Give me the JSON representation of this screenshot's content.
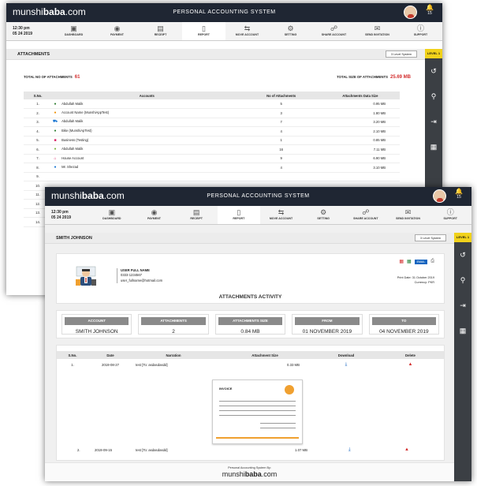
{
  "app": {
    "logo_prefix": "munshi",
    "logo_brand": "baba",
    "logo_suffix": ".com",
    "title": "PERSONAL ACCOUNTING SYSTEM",
    "notification_count": "15",
    "time": "12:30 pm",
    "date": "05 24 2019"
  },
  "nav": [
    {
      "label": "DASHBOARD",
      "icon": "dashboard-icon"
    },
    {
      "label": "PAYMENT",
      "icon": "payment-icon"
    },
    {
      "label": "RECEIPT",
      "icon": "receipt-icon"
    },
    {
      "label": "REPORT",
      "icon": "report-icon",
      "active": true
    },
    {
      "label": "MOVE ACCOUNT",
      "icon": "move-account-icon"
    },
    {
      "label": "SETTING",
      "icon": "gear-icon"
    },
    {
      "label": "SHARE ACCOUNT",
      "icon": "share-icon"
    },
    {
      "label": "SEND INVITATION",
      "icon": "invitation-icon"
    },
    {
      "label": "SUPPORT",
      "icon": "help-icon"
    }
  ],
  "sidebar": {
    "level": "LEVEL 1"
  },
  "level_system_btn": "3 Level System",
  "attachments_window": {
    "title": "ATTACHMENTS",
    "total_no_label": "TOTAL NO OF ATTACHMENTS",
    "total_no": "61",
    "total_size_label": "TOTAL SIZE OF ATTACHMENTS",
    "total_size": "25.69 MB",
    "columns": [
      "S.No.",
      "Accounts",
      "No of Attachments",
      "Attachments Data Size"
    ],
    "rows": [
      {
        "sno": "1.",
        "account": "Abdullah Malik",
        "count": "5",
        "size": "0.95 MB",
        "icon": "person-icon",
        "color": "#2e7d32"
      },
      {
        "sno": "2.",
        "account": "Account Name (MunshiAppTest)",
        "count": "3",
        "size": "1.80 MB",
        "icon": "person-icon",
        "color": "#ef8f00"
      },
      {
        "sno": "3.",
        "account": "Abdullah Malik",
        "count": "7",
        "size": "3.20 MB",
        "icon": "car-icon",
        "color": "#1976d2"
      },
      {
        "sno": "4.",
        "account": "Bike (MunshiApTest)",
        "count": "4",
        "size": "2.10 MB",
        "icon": "person-icon",
        "color": "#2e7d32"
      },
      {
        "sno": "5.",
        "account": "Business (Testing)",
        "count": "1",
        "size": "0.85 MB",
        "icon": "business-icon",
        "color": "#d81b60"
      },
      {
        "sno": "6.",
        "account": "Abdullah Malik",
        "count": "16",
        "size": "7.11 MB",
        "icon": "group-icon",
        "color": "#7cb342"
      },
      {
        "sno": "7.",
        "account": "House Account",
        "count": "9",
        "size": "6.90 MB",
        "icon": "house-icon",
        "color": "#d81b60"
      },
      {
        "sno": "8.",
        "account": "Mr. Shezad",
        "count": "4",
        "size": "3.10 MB",
        "icon": "person-icon",
        "color": "#1976d2"
      },
      {
        "sno": "9.",
        "account": "",
        "count": "",
        "size": "",
        "icon": "",
        "color": "#999"
      },
      {
        "sno": "10.",
        "account": "",
        "count": "",
        "size": "",
        "icon": "",
        "color": "#999"
      },
      {
        "sno": "11.",
        "account": "",
        "count": "",
        "size": "",
        "icon": "",
        "color": "#999"
      },
      {
        "sno": "12.",
        "account": "",
        "count": "",
        "size": "",
        "icon": "",
        "color": "#999"
      },
      {
        "sno": "13.",
        "account": "",
        "count": "",
        "size": "",
        "icon": "",
        "color": "#999"
      },
      {
        "sno": "14.",
        "account": "",
        "count": "",
        "size": "",
        "icon": "",
        "color": "#999"
      }
    ]
  },
  "detail_window": {
    "title": "SMITH JOHNSON",
    "user_name": "USER FULL NAME",
    "user_phone": "0333-1234567",
    "user_email": "user_fullname@hotmail.com",
    "print_date": "Print Date: 31 October 2019",
    "currency": "Currency: PKR",
    "activity_title": "ATTACHMENTS ACTIVITY",
    "email_btn": "EMAIL",
    "stats": [
      {
        "label": "ACCOUNT",
        "value": "SMITH JOHNSON"
      },
      {
        "label": "ATTACHMENTS",
        "value": "2"
      },
      {
        "label": "ATTACHMENTS SIZE",
        "value": "0.84 MB"
      },
      {
        "label": "FROM",
        "value": "01 NOVEMBER 2019"
      },
      {
        "label": "TO",
        "value": "04 NOVEMBER 2019"
      }
    ],
    "columns": [
      "S.No.",
      "Date",
      "Narration",
      "Attachment Size",
      "Download",
      "Delete"
    ],
    "rows": [
      {
        "sno": "1.",
        "date": "2019-08-27",
        "narration": "test [To: asdasdasdd]",
        "size": "0.33 MB"
      },
      {
        "sno": "2.",
        "date": "2019-09-15",
        "narration": "test [To: asdasdasdd]",
        "size": "1.07 MB"
      }
    ],
    "invoice_label": "INVOICE",
    "footer_text": "Personal Accounting System By:"
  }
}
